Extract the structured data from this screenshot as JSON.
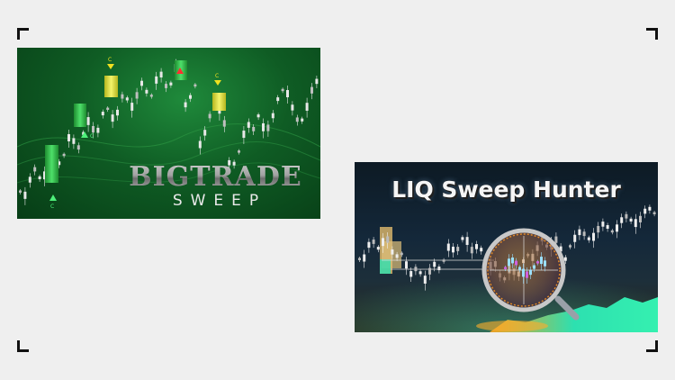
{
  "cards": {
    "left": {
      "title": "BIGTRADE",
      "subtitle": "SWEEP",
      "marker_label": "C"
    },
    "right": {
      "title": "LIQ Sweep Hunter"
    }
  },
  "colors": {
    "page_background": "#efefef",
    "left_card_green": "#0f5c24",
    "right_card_dark": "#14283a",
    "candle_green": "#2fbf4a",
    "candle_yellow": "#e3e340",
    "accent_orange": "#ffae2a",
    "accent_teal": "#2de0b0"
  },
  "icons": [
    "corner-bracket",
    "magnifying-glass-icon",
    "sweep-marker-icon"
  ]
}
